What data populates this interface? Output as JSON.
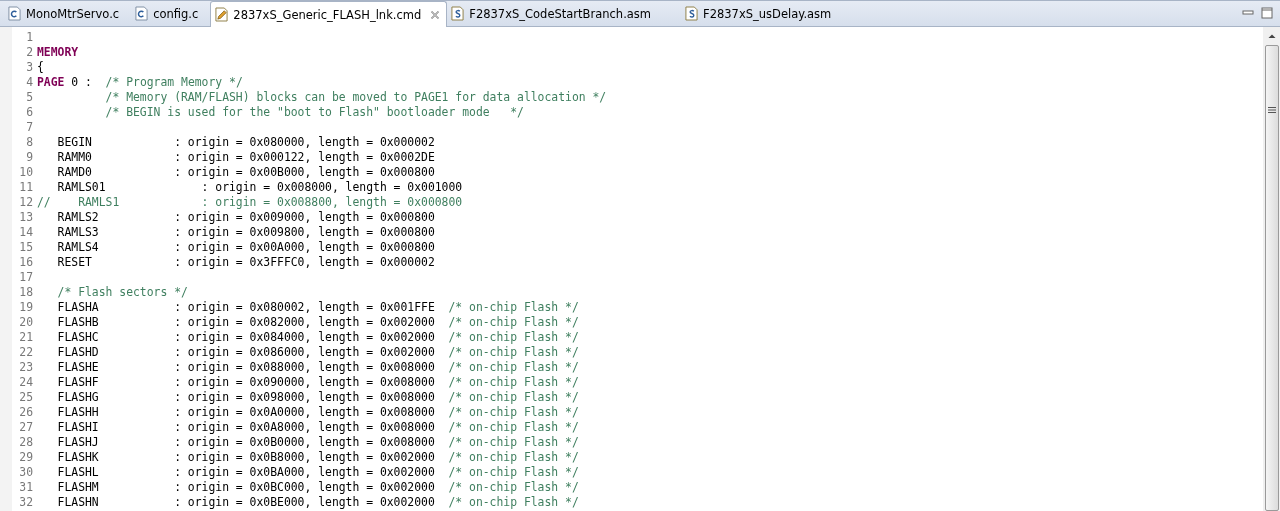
{
  "tabs": [
    {
      "label": "MonoMtrServo.c",
      "kind": "c",
      "selected": false
    },
    {
      "label": "config.c",
      "kind": "c",
      "selected": false
    },
    {
      "label": "2837xS_Generic_FLASH_lnk.cmd",
      "kind": "cmd",
      "selected": true
    },
    {
      "label": "F2837xS_CodeStartBranch.asm",
      "kind": "asm",
      "selected": false
    },
    {
      "label": "F2837xS_usDelay.asm",
      "kind": "asm",
      "selected": false
    }
  ],
  "editor": {
    "lines": [
      {
        "number": "1"
      },
      {
        "number": "2",
        "segments": [
          {
            "kind": "keyword",
            "text": "MEMORY"
          }
        ]
      },
      {
        "number": "3",
        "segments": [
          {
            "kind": "plain",
            "text": "{"
          }
        ]
      },
      {
        "number": "4",
        "segments": [
          {
            "kind": "keyword",
            "text": "PAGE"
          },
          {
            "kind": "plain",
            "text": " 0 :  "
          },
          {
            "kind": "comment",
            "text": "/* Program Memory */"
          }
        ]
      },
      {
        "number": "5",
        "segments": [
          {
            "kind": "comment",
            "text": "          /* Memory (RAM/FLASH) blocks can be moved to PAGE1 for data allocation */"
          }
        ]
      },
      {
        "number": "6",
        "segments": [
          {
            "kind": "comment",
            "text": "          /* BEGIN is used for the \"boot to Flash\" bootloader mode   */"
          }
        ]
      },
      {
        "number": "7"
      },
      {
        "number": "8",
        "segments": [
          {
            "kind": "plain",
            "text": "   BEGIN            : origin = 0x080000, length = 0x000002"
          }
        ]
      },
      {
        "number": "9",
        "segments": [
          {
            "kind": "plain",
            "text": "   RAMM0            : origin = 0x000122, length = 0x0002DE"
          }
        ]
      },
      {
        "number": "10",
        "segments": [
          {
            "kind": "plain",
            "text": "   RAMD0            : origin = 0x00B000, length = 0x000800"
          }
        ]
      },
      {
        "number": "11",
        "segments": [
          {
            "kind": "plain",
            "text": "   RAMLS01              : origin = 0x008000, length = 0x001000"
          }
        ]
      },
      {
        "number": "12",
        "segments": [
          {
            "kind": "comment",
            "text": "//    RAMLS1            : origin = 0x008800, length = 0x000800"
          }
        ]
      },
      {
        "number": "13",
        "segments": [
          {
            "kind": "plain",
            "text": "   RAMLS2           : origin = 0x009000, length = 0x000800"
          }
        ]
      },
      {
        "number": "14",
        "segments": [
          {
            "kind": "plain",
            "text": "   RAMLS3           : origin = 0x009800, length = 0x000800"
          }
        ]
      },
      {
        "number": "15",
        "segments": [
          {
            "kind": "plain",
            "text": "   RAMLS4           : origin = 0x00A000, length = 0x000800"
          }
        ]
      },
      {
        "number": "16",
        "segments": [
          {
            "kind": "plain",
            "text": "   RESET            : origin = 0x3FFFC0, length = 0x000002"
          }
        ]
      },
      {
        "number": "17"
      },
      {
        "number": "18",
        "segments": [
          {
            "kind": "comment",
            "text": "   /* Flash sectors */"
          }
        ]
      },
      {
        "number": "19",
        "segments": [
          {
            "kind": "plain",
            "text": "   FLASHA           : origin = 0x080002, length = 0x001FFE  "
          },
          {
            "kind": "comment",
            "text": "/* on-chip Flash */"
          }
        ]
      },
      {
        "number": "20",
        "segments": [
          {
            "kind": "plain",
            "text": "   FLASHB           : origin = 0x082000, length = 0x002000  "
          },
          {
            "kind": "comment",
            "text": "/* on-chip Flash */"
          }
        ]
      },
      {
        "number": "21",
        "segments": [
          {
            "kind": "plain",
            "text": "   FLASHC           : origin = 0x084000, length = 0x002000  "
          },
          {
            "kind": "comment",
            "text": "/* on-chip Flash */"
          }
        ]
      },
      {
        "number": "22",
        "segments": [
          {
            "kind": "plain",
            "text": "   FLASHD           : origin = 0x086000, length = 0x002000  "
          },
          {
            "kind": "comment",
            "text": "/* on-chip Flash */"
          }
        ]
      },
      {
        "number": "23",
        "segments": [
          {
            "kind": "plain",
            "text": "   FLASHE           : origin = 0x088000, length = 0x008000  "
          },
          {
            "kind": "comment",
            "text": "/* on-chip Flash */"
          }
        ]
      },
      {
        "number": "24",
        "segments": [
          {
            "kind": "plain",
            "text": "   FLASHF           : origin = 0x090000, length = 0x008000  "
          },
          {
            "kind": "comment",
            "text": "/* on-chip Flash */"
          }
        ]
      },
      {
        "number": "25",
        "segments": [
          {
            "kind": "plain",
            "text": "   FLASHG           : origin = 0x098000, length = 0x008000  "
          },
          {
            "kind": "comment",
            "text": "/* on-chip Flash */"
          }
        ]
      },
      {
        "number": "26",
        "segments": [
          {
            "kind": "plain",
            "text": "   FLASHH           : origin = 0x0A0000, length = 0x008000  "
          },
          {
            "kind": "comment",
            "text": "/* on-chip Flash */"
          }
        ]
      },
      {
        "number": "27",
        "segments": [
          {
            "kind": "plain",
            "text": "   FLASHI           : origin = 0x0A8000, length = 0x008000  "
          },
          {
            "kind": "comment",
            "text": "/* on-chip Flash */"
          }
        ]
      },
      {
        "number": "28",
        "segments": [
          {
            "kind": "plain",
            "text": "   FLASHJ           : origin = 0x0B0000, length = 0x008000  "
          },
          {
            "kind": "comment",
            "text": "/* on-chip Flash */"
          }
        ]
      },
      {
        "number": "29",
        "segments": [
          {
            "kind": "plain",
            "text": "   FLASHK           : origin = 0x0B8000, length = 0x002000  "
          },
          {
            "kind": "comment",
            "text": "/* on-chip Flash */"
          }
        ]
      },
      {
        "number": "30",
        "segments": [
          {
            "kind": "plain",
            "text": "   FLASHL           : origin = 0x0BA000, length = 0x002000  "
          },
          {
            "kind": "comment",
            "text": "/* on-chip Flash */"
          }
        ]
      },
      {
        "number": "31",
        "segments": [
          {
            "kind": "plain",
            "text": "   FLASHM           : origin = 0x0BC000, length = 0x002000  "
          },
          {
            "kind": "comment",
            "text": "/* on-chip Flash */"
          }
        ]
      },
      {
        "number": "32",
        "segments": [
          {
            "kind": "plain",
            "text": "   FLASHN           : origin = 0x0BE000, length = 0x002000  "
          },
          {
            "kind": "comment",
            "text": "/* on-chip Flash */"
          }
        ]
      }
    ]
  }
}
